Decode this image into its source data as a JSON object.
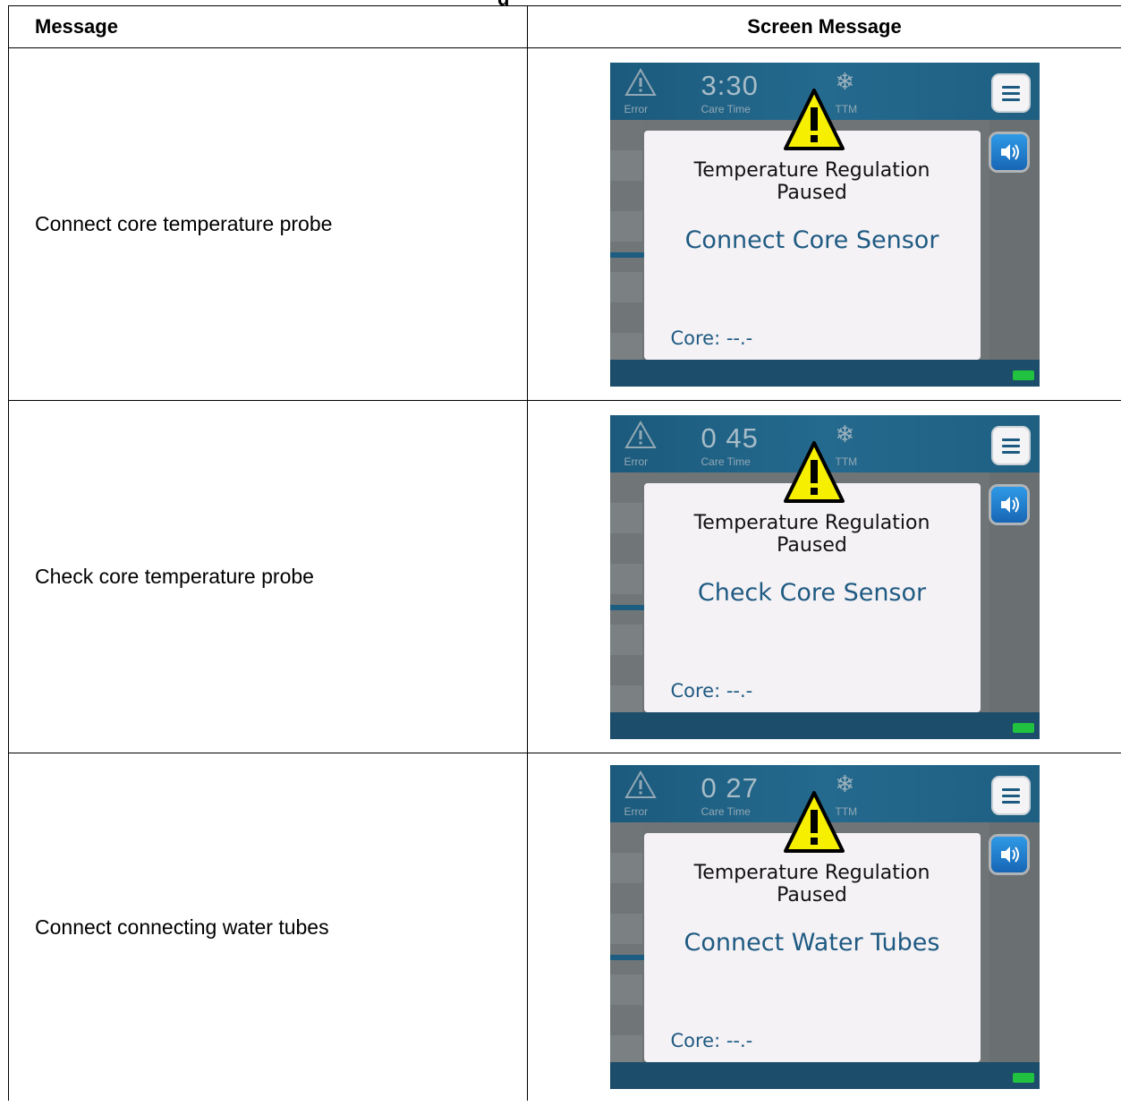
{
  "table": {
    "header_message": "Message",
    "header_screen": "Screen Message",
    "cutoff_heading": "g",
    "rows": [
      {
        "message": "Connect core temperature probe",
        "screen": {
          "error_label": "Error",
          "care_time": "3:30",
          "care_time_label": "Care Time",
          "ttm_label": "TTM",
          "dialog_title_line1": "Temperature Regulation",
          "dialog_title_line2": "Paused",
          "dialog_message": "Connect Core Sensor",
          "core_label": "Core: --.-"
        }
      },
      {
        "message": "Check core temperature probe",
        "screen": {
          "error_label": "Error",
          "care_time": "0 45",
          "care_time_label": "Care Time",
          "ttm_label": "TTM",
          "dialog_title_line1": "Temperature Regulation",
          "dialog_title_line2": "Paused",
          "dialog_message": "Check Core Sensor",
          "core_label": "Core: --.-"
        }
      },
      {
        "message": "Connect connecting water tubes",
        "screen": {
          "error_label": "Error",
          "care_time": "0 27",
          "care_time_label": "Care Time",
          "ttm_label": "TTM",
          "dialog_title_line1": "Temperature Regulation",
          "dialog_title_line2": "Paused",
          "dialog_message": "Connect Water Tubes",
          "core_label": "Core: --.-"
        }
      }
    ]
  },
  "icons": {
    "error": "warning-outline-icon",
    "ttm": "snowflake-icon",
    "menu": "hamburger-menu-icon",
    "sound": "speaker-icon",
    "alert": "warning-triangle-icon",
    "battery": "battery-icon"
  },
  "colors": {
    "topbar": "#1f5f82",
    "dialog_text_accent": "#1e5a82",
    "warning_yellow": "#f7ef00",
    "battery": "#21c23f"
  }
}
